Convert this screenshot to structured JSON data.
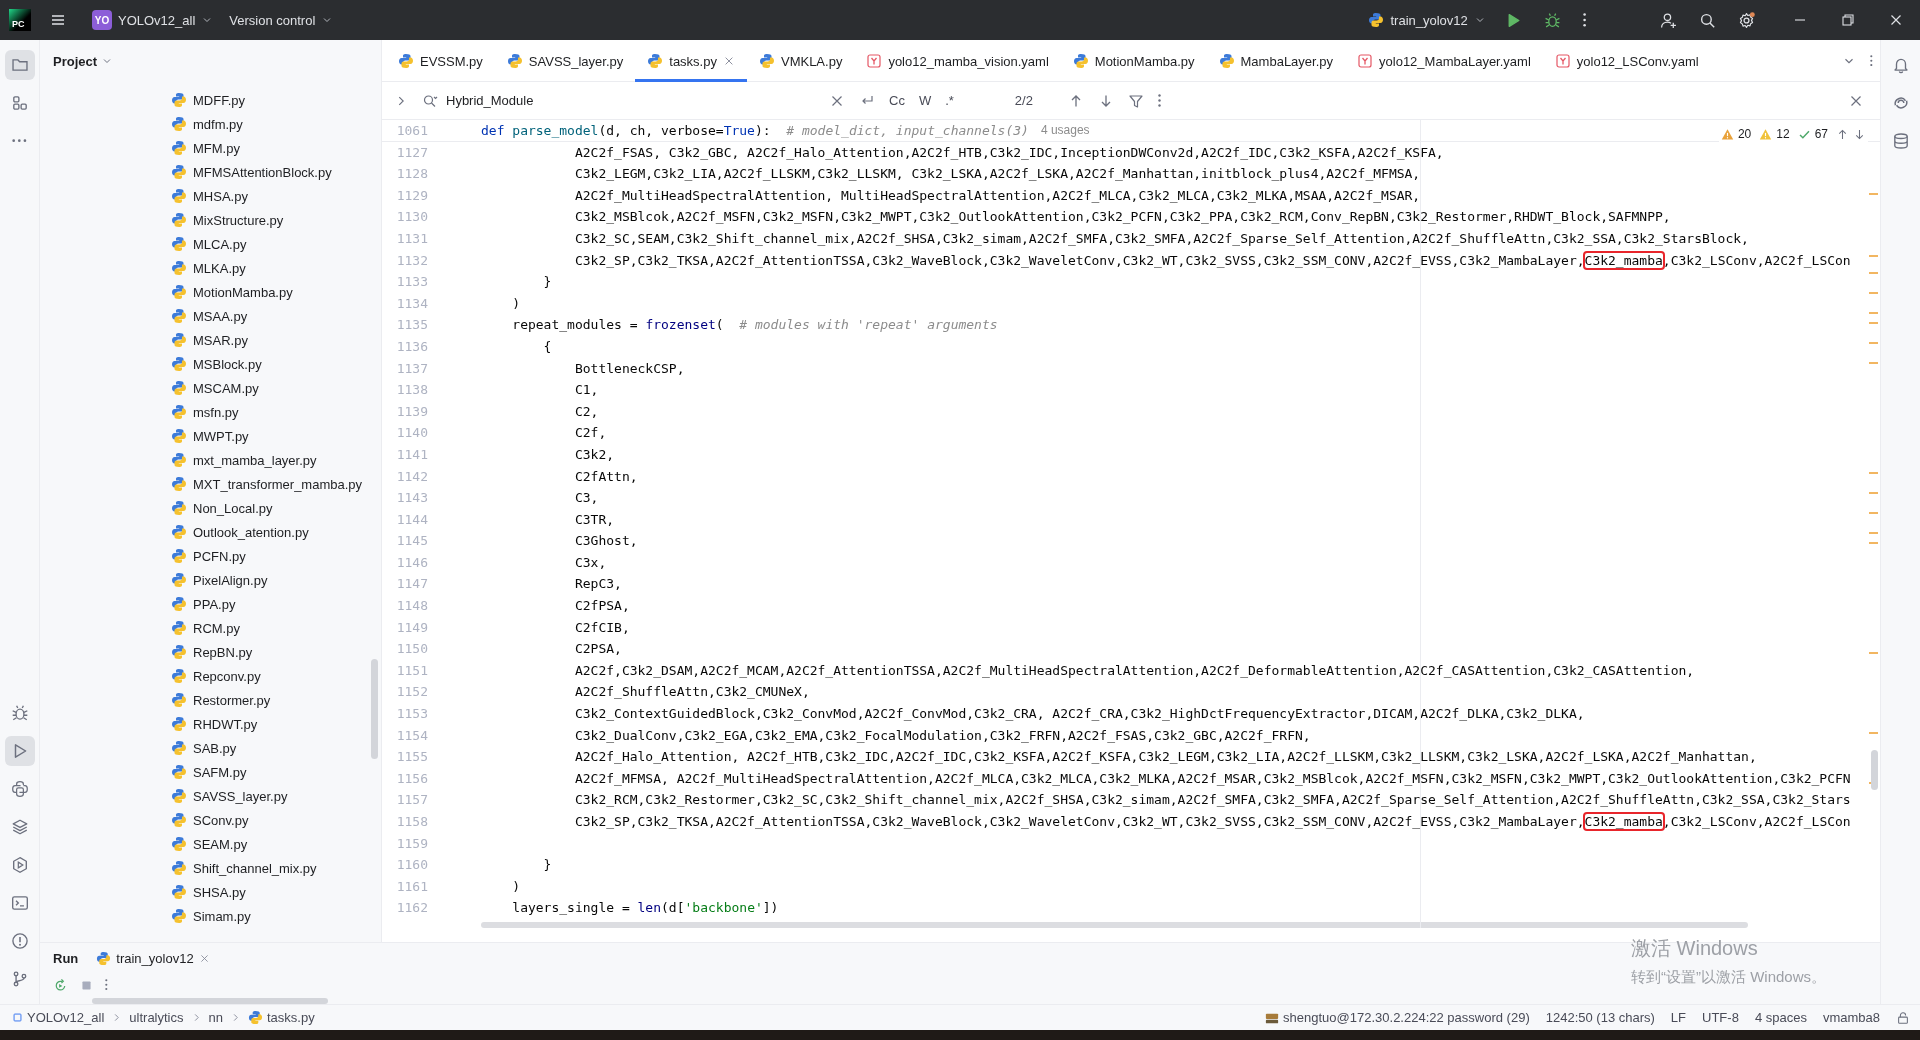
{
  "app": {
    "logo": "PC",
    "project_badge": "YO",
    "project": "YOLOv12_all",
    "vcs": "Version control",
    "run_config": "train_yolov12"
  },
  "left_toolbar_top": [
    {
      "kind": "project",
      "selected": true
    },
    {
      "kind": "structure",
      "selected": false
    },
    {
      "kind": "more",
      "selected": false
    }
  ],
  "left_toolbar_bottom": [
    {
      "kind": "debug",
      "selected": false
    },
    {
      "kind": "run",
      "selected": true
    },
    {
      "kind": "python",
      "selected": false
    },
    {
      "kind": "layers",
      "selected": false
    },
    {
      "kind": "services",
      "selected": false
    },
    {
      "kind": "terminal",
      "selected": false
    },
    {
      "kind": "problems",
      "selected": false
    },
    {
      "kind": "git",
      "selected": false
    }
  ],
  "right_toolbar": [
    {
      "kind": "notifications"
    },
    {
      "kind": "assistant"
    },
    {
      "kind": "database"
    }
  ],
  "project_panel": {
    "title": "Project",
    "files": [
      "MDFF.py",
      "mdfm.py",
      "MFM.py",
      "MFMSAttentionBlock.py",
      "MHSA.py",
      "MixStructure.py",
      "MLCA.py",
      "MLKA.py",
      "MotionMamba.py",
      "MSAA.py",
      "MSAR.py",
      "MSBlock.py",
      "MSCAM.py",
      "msfn.py",
      "MWPT.py",
      "mxt_mamba_layer.py",
      "MXT_transformer_mamba.py",
      "Non_Local.py",
      "Outlook_atention.py",
      "PCFN.py",
      "PixelAlign.py",
      "PPA.py",
      "RCM.py",
      "RepBN.py",
      "Repconv.py",
      "Restormer.py",
      "RHDWT.py",
      "SAB.py",
      "SAFM.py",
      "SAVSS_layer.py",
      "SConv.py",
      "SEAM.py",
      "Shift_channel_mix.py",
      "SHSA.py",
      "Simam.py"
    ]
  },
  "tabs": [
    {
      "label": "EVSSM.py",
      "kind": "python",
      "selected": false
    },
    {
      "label": "SAVSS_layer.py",
      "kind": "python",
      "selected": false
    },
    {
      "label": "tasks.py",
      "kind": "python",
      "selected": true
    },
    {
      "label": "VMKLA.py",
      "kind": "python",
      "selected": false
    },
    {
      "label": "yolo12_mamba_vision.yaml",
      "kind": "yaml",
      "selected": false
    },
    {
      "label": "MotionMamba.py",
      "kind": "python",
      "selected": false
    },
    {
      "label": "MambaLayer.py",
      "kind": "python",
      "selected": false
    },
    {
      "label": "yolo12_MambaLayer.yaml",
      "kind": "yaml",
      "selected": false
    },
    {
      "label": "yolo12_LSConv.yaml",
      "kind": "yaml",
      "selected": false
    }
  ],
  "find": {
    "query": "Hybrid_Module",
    "match_case": "Cc",
    "words": "W",
    "regex": ".*",
    "count": "2/2"
  },
  "inspections": [
    {
      "kind": "warning",
      "count": "20"
    },
    {
      "kind": "weak",
      "count": "12"
    },
    {
      "kind": "ok",
      "count": "67"
    }
  ],
  "editor": {
    "sticky": {
      "number": "1061",
      "tokens": [
        {
          "text": "def",
          "kind": "keyword"
        },
        {
          "text": " parse_model",
          "kind": "func"
        },
        {
          "text": "(d, ch, verbose=",
          "kind": "plain"
        },
        {
          "text": "True",
          "kind": "keyword"
        },
        {
          "text": "):  ",
          "kind": "plain"
        },
        {
          "text": "# model_dict, input_channels(3)",
          "kind": "comment"
        }
      ],
      "hint": "4 usages"
    },
    "lines": [
      {
        "number": "1127",
        "tokens": [
          {
            "text": "            A2C2f_FSAS, C3k2_GBC, A2C2f_Halo_Attention,A2C2f_HTB,C3k2_IDC,InceptionDWConv2d,A2C2f_IDC,C3k2_KSFA,A2C2f_KSFA,",
            "kind": "plain"
          }
        ]
      },
      {
        "number": "1128",
        "tokens": [
          {
            "text": "            C3k2_LEGM,C3k2_LIA,A2C2f_LLSKM,C3k2_LLSKM, C3k2_LSKA,A2C2f_LSKA,A2C2f_Manhattan,initblock_plus4,A2C2f_MFMSA,",
            "kind": "plain"
          }
        ]
      },
      {
        "number": "1129",
        "tokens": [
          {
            "text": "            A2C2f_MultiHeadSpectralAttention, MultiHeadSpectralAttention,A2C2f_MLCA,C3k2_MLCA,C3k2_MLKA,MSAA,A2C2f_MSAR,",
            "kind": "plain"
          }
        ]
      },
      {
        "number": "1130",
        "tokens": [
          {
            "text": "            C3k2_MSBlcok,A2C2f_MSFN,C3k2_MSFN,C3k2_MWPT,C3k2_OutlookAttention,C3k2_PCFN,C3k2_PPA,C3k2_RCM,Conv_RepBN,C3k2_Restormer,RHDWT_Block,SAFMNPP,",
            "kind": "plain"
          }
        ]
      },
      {
        "number": "1131",
        "tokens": [
          {
            "text": "            C3k2_SC,SEAM,C3k2_Shift_channel_mix,A2C2f_SHSA,C3k2_simam,A2C2f_SMFA,C3k2_SMFA,A2C2f_Sparse_Self_Attention,A2C2f_ShuffleAttn,C3k2_SSA,C3k2_StarsBlock,",
            "kind": "plain"
          }
        ]
      },
      {
        "number": "1132",
        "tokens": [
          {
            "text": "            C3k2_SP,C3k2_TKSA,A2C2f_AttentionTSSA,C3k2_WaveBlock,C3k2_WaveletConv,C3k2_WT,C3k2_SVSS,C3k2_SSM_CONV,A2C2f_EVSS,C3k2_MambaLayer,",
            "kind": "plain"
          },
          {
            "text": "C3k2_mamba",
            "kind": "match"
          },
          {
            "text": ",C3k2_LSConv,A2C2f_LSCon",
            "kind": "plain"
          }
        ]
      },
      {
        "number": "1133",
        "tokens": [
          {
            "text": "        }",
            "kind": "plain"
          }
        ]
      },
      {
        "number": "1134",
        "tokens": [
          {
            "text": "    )",
            "kind": "plain"
          }
        ]
      },
      {
        "number": "1135",
        "tokens": [
          {
            "text": "    repeat_modules = ",
            "kind": "plain"
          },
          {
            "text": "frozenset",
            "kind": "builtin"
          },
          {
            "text": "(  ",
            "kind": "plain"
          },
          {
            "text": "# modules with 'repeat' arguments",
            "kind": "comment"
          }
        ]
      },
      {
        "number": "1136",
        "tokens": [
          {
            "text": "        {",
            "kind": "plain"
          }
        ]
      },
      {
        "number": "1137",
        "tokens": [
          {
            "text": "            BottleneckCSP,",
            "kind": "plain"
          }
        ]
      },
      {
        "number": "1138",
        "tokens": [
          {
            "text": "            C1,",
            "kind": "plain"
          }
        ]
      },
      {
        "number": "1139",
        "tokens": [
          {
            "text": "            C2,",
            "kind": "plain"
          }
        ]
      },
      {
        "number": "1140",
        "tokens": [
          {
            "text": "            C2f,",
            "kind": "plain"
          }
        ]
      },
      {
        "number": "1141",
        "tokens": [
          {
            "text": "            C3k2,",
            "kind": "plain"
          }
        ]
      },
      {
        "number": "1142",
        "tokens": [
          {
            "text": "            C2fAttn,",
            "kind": "plain"
          }
        ]
      },
      {
        "number": "1143",
        "tokens": [
          {
            "text": "            C3,",
            "kind": "plain"
          }
        ]
      },
      {
        "number": "1144",
        "tokens": [
          {
            "text": "            C3TR,",
            "kind": "plain"
          }
        ]
      },
      {
        "number": "1145",
        "tokens": [
          {
            "text": "            C3Ghost,",
            "kind": "plain"
          }
        ]
      },
      {
        "number": "1146",
        "tokens": [
          {
            "text": "            C3x,",
            "kind": "plain"
          }
        ]
      },
      {
        "number": "1147",
        "tokens": [
          {
            "text": "            RepC3,",
            "kind": "plain"
          }
        ]
      },
      {
        "number": "1148",
        "tokens": [
          {
            "text": "            C2fPSA,",
            "kind": "plain"
          }
        ]
      },
      {
        "number": "1149",
        "tokens": [
          {
            "text": "            C2fCIB,",
            "kind": "plain"
          }
        ]
      },
      {
        "number": "1150",
        "tokens": [
          {
            "text": "            C2PSA,",
            "kind": "plain"
          }
        ]
      },
      {
        "number": "1151",
        "tokens": [
          {
            "text": "            A2C2f,C3k2_DSAM,A2C2f_MCAM,A2C2f_AttentionTSSA,A2C2f_MultiHeadSpectralAttention,A2C2f_DeformableAttention,A2C2f_CASAttention,C3k2_CASAttention,",
            "kind": "plain"
          }
        ]
      },
      {
        "number": "1152",
        "tokens": [
          {
            "text": "            A2C2f_ShuffleAttn,C3k2_CMUNeX,",
            "kind": "plain"
          }
        ]
      },
      {
        "number": "1153",
        "tokens": [
          {
            "text": "            C3k2_ContextGuidedBlock,C3k2_ConvMod,A2C2f_ConvMod,C3k2_CRA, A2C2f_CRA,C3k2_HighDctFrequencyExtractor,DICAM,A2C2f_DLKA,C3k2_DLKA,",
            "kind": "plain"
          }
        ]
      },
      {
        "number": "1154",
        "tokens": [
          {
            "text": "            C3k2_DualConv,C3k2_EGA,C3k2_EMA,C3k2_FocalModulation,C3k2_FRFN,A2C2f_FSAS,C3k2_GBC,A2C2f_FRFN,",
            "kind": "plain"
          }
        ]
      },
      {
        "number": "1155",
        "tokens": [
          {
            "text": "            A2C2f_Halo_Attention, A2C2f_HTB,C3k2_IDC,A2C2f_IDC,C3k2_KSFA,A2C2f_KSFA,C3k2_LEGM,C3k2_LIA,A2C2f_LLSKM,C3k2_LLSKM,C3k2_LSKA,A2C2f_LSKA,A2C2f_Manhattan,",
            "kind": "plain"
          }
        ]
      },
      {
        "number": "1156",
        "tokens": [
          {
            "text": "            A2C2f_MFMSA, A2C2f_MultiHeadSpectralAttention,A2C2f_MLCA,C3k2_MLCA,C3k2_MLKA,A2C2f_MSAR,C3k2_MSBlcok,A2C2f_MSFN,C3k2_MSFN,C3k2_MWPT,C3k2_OutlookAttention,C3k2_PCFN",
            "kind": "plain"
          }
        ]
      },
      {
        "number": "1157",
        "tokens": [
          {
            "text": "            C3k2_RCM,C3k2_Restormer,C3k2_SC,C3k2_Shift_channel_mix,A2C2f_SHSA,C3k2_simam,A2C2f_SMFA,C3k2_SMFA,A2C2f_Sparse_Self_Attention,A2C2f_ShuffleAttn,C3k2_SSA,C3k2_Stars",
            "kind": "plain"
          }
        ]
      },
      {
        "number": "1158",
        "tokens": [
          {
            "text": "            C3k2_SP,C3k2_TKSA,A2C2f_AttentionTSSA,C3k2_WaveBlock,C3k2_WaveletConv,C3k2_WT,C3k2_SVSS,C3k2_SSM_CONV,A2C2f_EVSS,C3k2_MambaLayer,",
            "kind": "plain"
          },
          {
            "text": "C3k2_mamba",
            "kind": "match"
          },
          {
            "text": ",C3k2_LSConv,A2C2f_LSCon",
            "kind": "plain"
          }
        ]
      },
      {
        "number": "1159"
      },
      {
        "number": "1160",
        "tokens": [
          {
            "text": "        }",
            "kind": "plain"
          }
        ]
      },
      {
        "number": "1161",
        "tokens": [
          {
            "text": "    )",
            "kind": "plain"
          }
        ]
      },
      {
        "number": "1162",
        "tokens": [
          {
            "text": "    layers_single = ",
            "kind": "plain"
          },
          {
            "text": "len",
            "kind": "builtin"
          },
          {
            "text": "(d[",
            "kind": "plain"
          },
          {
            "text": "'backbone'",
            "kind": "string"
          },
          {
            "text": "])",
            "kind": "plain"
          }
        ]
      }
    ]
  },
  "run_panel": {
    "title": "Run",
    "tab": "train_yolov12"
  },
  "status_bar": {
    "breadcrumbs": [
      {
        "label": "YOLOv12_all",
        "kind": "module"
      },
      {
        "label": "ultralytics",
        "kind": "folder"
      },
      {
        "label": "nn",
        "kind": "folder"
      },
      {
        "label": "tasks.py",
        "kind": "python"
      }
    ],
    "items": [
      {
        "label": "shengtuo@172.30.2.224:22 password (29)",
        "kind": "sftp"
      },
      {
        "label": "1242:50 (13 chars)",
        "kind": "text"
      },
      {
        "label": "LF",
        "kind": "text"
      },
      {
        "label": "UTF-8",
        "kind": "text"
      },
      {
        "label": "4 spaces",
        "kind": "text"
      },
      {
        "label": "vmamba8",
        "kind": "text"
      }
    ]
  },
  "os_notice": {
    "title": "激活 Windows",
    "text": "转到“设置”以激活 Windows。"
  }
}
